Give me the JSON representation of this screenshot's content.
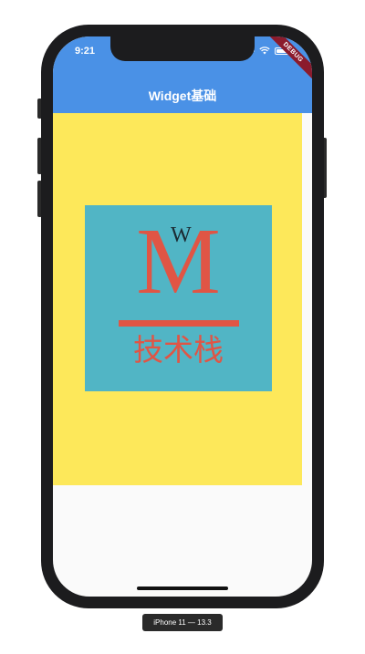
{
  "status_bar": {
    "time": "9:21",
    "icons": [
      "signal-icon",
      "wifi-icon",
      "battery-icon"
    ]
  },
  "app_bar": {
    "title": "Widget基础",
    "color": "#4a91e6"
  },
  "debug_banner": {
    "label": "DEBUG",
    "color": "#8b1b2c"
  },
  "content": {
    "container_color": "#fde85a",
    "logo": {
      "background": "#51b5c5",
      "big_letter": "M",
      "small_letter": "W",
      "text": "技术栈",
      "accent_color": "#e05545"
    }
  },
  "simulator": {
    "label": "iPhone 11 — 13.3"
  }
}
